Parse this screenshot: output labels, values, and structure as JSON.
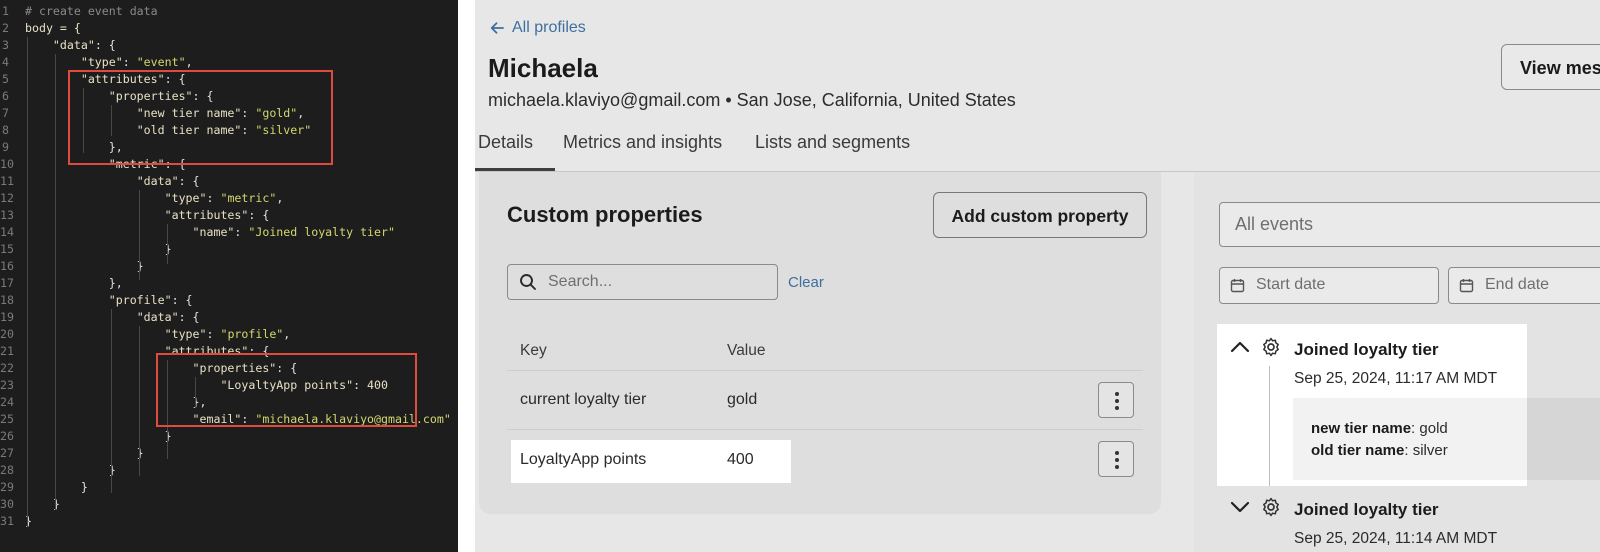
{
  "code_editor": {
    "lines": [
      {
        "num": "1",
        "tokens": [
          {
            "t": "# create event data",
            "c": "c"
          }
        ]
      },
      {
        "num": "2",
        "tokens": [
          {
            "t": "body = {",
            "c": "k"
          }
        ]
      },
      {
        "num": "3",
        "tokens": [
          {
            "t": "    ",
            "c": "p"
          },
          {
            "t": "\"data\"",
            "c": "k"
          },
          {
            "t": ": {",
            "c": "p"
          }
        ]
      },
      {
        "num": "4",
        "tokens": [
          {
            "t": "        ",
            "c": "p"
          },
          {
            "t": "\"type\"",
            "c": "k"
          },
          {
            "t": ": ",
            "c": "p"
          },
          {
            "t": "\"event\"",
            "c": "s"
          },
          {
            "t": ",",
            "c": "p"
          }
        ]
      },
      {
        "num": "5",
        "tokens": [
          {
            "t": "        ",
            "c": "p"
          },
          {
            "t": "\"attributes\"",
            "c": "k"
          },
          {
            "t": ": {",
            "c": "p"
          }
        ]
      },
      {
        "num": "6",
        "tokens": [
          {
            "t": "            ",
            "c": "p"
          },
          {
            "t": "\"properties\"",
            "c": "k"
          },
          {
            "t": ": {",
            "c": "p"
          }
        ]
      },
      {
        "num": "7",
        "tokens": [
          {
            "t": "                ",
            "c": "p"
          },
          {
            "t": "\"new tier name\"",
            "c": "k"
          },
          {
            "t": ": ",
            "c": "p"
          },
          {
            "t": "\"gold\"",
            "c": "s"
          },
          {
            "t": ",",
            "c": "p"
          }
        ]
      },
      {
        "num": "8",
        "tokens": [
          {
            "t": "                ",
            "c": "p"
          },
          {
            "t": "\"old tier name\"",
            "c": "k"
          },
          {
            "t": ": ",
            "c": "p"
          },
          {
            "t": "\"silver\"",
            "c": "s"
          }
        ]
      },
      {
        "num": "9",
        "tokens": [
          {
            "t": "            },",
            "c": "p"
          }
        ]
      },
      {
        "num": "10",
        "tokens": [
          {
            "t": "            ",
            "c": "p"
          },
          {
            "t": "\"metric\"",
            "c": "k"
          },
          {
            "t": ": {",
            "c": "p"
          }
        ]
      },
      {
        "num": "11",
        "tokens": [
          {
            "t": "                ",
            "c": "p"
          },
          {
            "t": "\"data\"",
            "c": "k"
          },
          {
            "t": ": {",
            "c": "p"
          }
        ]
      },
      {
        "num": "12",
        "tokens": [
          {
            "t": "                    ",
            "c": "p"
          },
          {
            "t": "\"type\"",
            "c": "k"
          },
          {
            "t": ": ",
            "c": "p"
          },
          {
            "t": "\"metric\"",
            "c": "s"
          },
          {
            "t": ",",
            "c": "p"
          }
        ]
      },
      {
        "num": "13",
        "tokens": [
          {
            "t": "                    ",
            "c": "p"
          },
          {
            "t": "\"attributes\"",
            "c": "k"
          },
          {
            "t": ": {",
            "c": "p"
          }
        ]
      },
      {
        "num": "14",
        "tokens": [
          {
            "t": "                        ",
            "c": "p"
          },
          {
            "t": "\"name\"",
            "c": "k"
          },
          {
            "t": ": ",
            "c": "p"
          },
          {
            "t": "\"Joined loyalty tier\"",
            "c": "s"
          }
        ]
      },
      {
        "num": "15",
        "tokens": [
          {
            "t": "                    }",
            "c": "p"
          }
        ]
      },
      {
        "num": "16",
        "tokens": [
          {
            "t": "                }",
            "c": "p"
          }
        ]
      },
      {
        "num": "17",
        "tokens": [
          {
            "t": "            },",
            "c": "p"
          }
        ]
      },
      {
        "num": "18",
        "tokens": [
          {
            "t": "            ",
            "c": "p"
          },
          {
            "t": "\"profile\"",
            "c": "k"
          },
          {
            "t": ": {",
            "c": "p"
          }
        ]
      },
      {
        "num": "19",
        "tokens": [
          {
            "t": "                ",
            "c": "p"
          },
          {
            "t": "\"data\"",
            "c": "k"
          },
          {
            "t": ": {",
            "c": "p"
          }
        ]
      },
      {
        "num": "20",
        "tokens": [
          {
            "t": "                    ",
            "c": "p"
          },
          {
            "t": "\"type\"",
            "c": "k"
          },
          {
            "t": ": ",
            "c": "p"
          },
          {
            "t": "\"profile\"",
            "c": "s"
          },
          {
            "t": ",",
            "c": "p"
          }
        ]
      },
      {
        "num": "21",
        "tokens": [
          {
            "t": "                    ",
            "c": "p"
          },
          {
            "t": "\"attributes\"",
            "c": "k"
          },
          {
            "t": ": {",
            "c": "p"
          }
        ]
      },
      {
        "num": "22",
        "tokens": [
          {
            "t": "                        ",
            "c": "p"
          },
          {
            "t": "\"properties\"",
            "c": "k"
          },
          {
            "t": ": {",
            "c": "p"
          }
        ]
      },
      {
        "num": "23",
        "tokens": [
          {
            "t": "                            ",
            "c": "p"
          },
          {
            "t": "\"LoyaltyApp points\"",
            "c": "k"
          },
          {
            "t": ": ",
            "c": "p"
          },
          {
            "t": "400",
            "c": "n"
          }
        ]
      },
      {
        "num": "24",
        "tokens": [
          {
            "t": "                        },",
            "c": "p"
          }
        ]
      },
      {
        "num": "25",
        "tokens": [
          {
            "t": "                        ",
            "c": "p"
          },
          {
            "t": "\"email\"",
            "c": "k"
          },
          {
            "t": ": ",
            "c": "p"
          },
          {
            "t": "\"michaela.klaviyo@gmail.com\"",
            "c": "s"
          }
        ]
      },
      {
        "num": "26",
        "tokens": [
          {
            "t": "                    }",
            "c": "p"
          }
        ]
      },
      {
        "num": "27",
        "tokens": [
          {
            "t": "                }",
            "c": "p"
          }
        ]
      },
      {
        "num": "28",
        "tokens": [
          {
            "t": "            }",
            "c": "p"
          }
        ]
      },
      {
        "num": "29",
        "tokens": [
          {
            "t": "        }",
            "c": "p"
          }
        ]
      },
      {
        "num": "30",
        "tokens": [
          {
            "t": "    }",
            "c": "p"
          }
        ]
      },
      {
        "num": "31",
        "tokens": [
          {
            "t": "}",
            "c": "p"
          }
        ]
      }
    ]
  },
  "profile_page": {
    "back_link": "All profiles",
    "name": "Michaela",
    "subtitle": "michaela.klaviyo@gmail.com • San Jose, California, United States",
    "view_button": "View mes",
    "tabs": [
      "Details",
      "Metrics and insights",
      "Lists and segments"
    ],
    "active_tab": "Details",
    "custom_properties": {
      "title": "Custom properties",
      "add_button": "Add custom property",
      "search_placeholder": "Search...",
      "clear_link": "Clear",
      "columns": [
        "Key",
        "Value"
      ],
      "rows": [
        {
          "key": "current loyalty tier",
          "value": "gold"
        },
        {
          "key": "LoyaltyApp points",
          "value": "400"
        }
      ]
    },
    "activity": {
      "filter_placeholder": "All events",
      "start_date_placeholder": "Start date",
      "end_date_placeholder": "End date",
      "events": [
        {
          "title": "Joined loyalty tier",
          "timestamp": "Sep 25, 2024, 11:17 AM MDT",
          "expanded": true,
          "properties": [
            {
              "key": "new tier name",
              "value": "gold"
            },
            {
              "key": "old tier name",
              "value": "silver"
            }
          ]
        },
        {
          "title": "Joined loyalty tier",
          "timestamp": "Sep 25, 2024, 11:14 AM MDT",
          "expanded": false
        }
      ]
    }
  },
  "colors": {
    "code_background": "#1d1d1d",
    "highlight_box": "#e04b3f",
    "link": "#3e6f9f"
  }
}
